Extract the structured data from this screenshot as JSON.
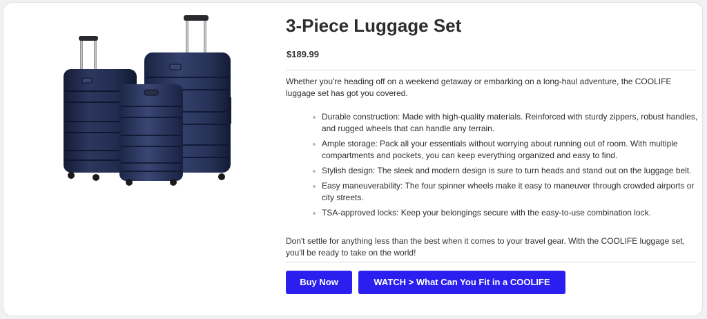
{
  "product": {
    "title": "3-Piece Luggage Set",
    "price": "$189.99",
    "intro": "Whether you're heading off on a weekend getaway or embarking on a long-haul adventure, the COOLIFE luggage set has got you covered.",
    "features": [
      "Durable construction: Made with high-quality materials. Reinforced with sturdy zippers, robust handles, and rugged wheels that can handle any terrain.",
      "Ample storage: Pack all your essentials without worrying about running out of room. With multiple compartments and pockets, you can keep everything organized and easy to find.",
      "Stylish design: The sleek and modern design is sure to turn heads and stand out on the luggage belt.",
      "Easy maneuverability: The four spinner wheels make it easy to maneuver through crowded airports or city streets.",
      "TSA-approved locks: Keep your belongings secure with the easy-to-use combination lock."
    ],
    "outro": "Don't settle for anything less than the best when it comes to your travel gear. With the COOLIFE luggage set, you'll be ready to take on the world!"
  },
  "actions": {
    "buy_label": "Buy Now",
    "watch_label": "WATCH > What Can You Fit in a COOLIFE"
  },
  "colors": {
    "accent": "#2b1ff0",
    "luggage": "#1f2a4d"
  },
  "icons": {
    "product_image": "luggage-set-image"
  }
}
